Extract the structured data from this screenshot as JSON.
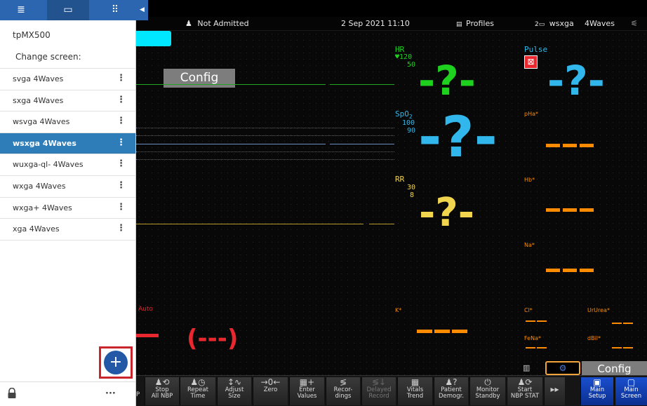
{
  "panel": {
    "title": "tpMX500",
    "heading": "Change screen:",
    "tabs": [
      {
        "icon": "list-settings-icon",
        "glyph": "≣"
      },
      {
        "icon": "screen-settings-icon",
        "glyph": "▭"
      },
      {
        "icon": "grid-icon",
        "glyph": "⠿"
      }
    ],
    "collapse_glyph": "◀",
    "screens": [
      {
        "label": "svga 4Waves",
        "selected": false
      },
      {
        "label": "sxga 4Waves",
        "selected": false
      },
      {
        "label": "wsvga 4Waves",
        "selected": false
      },
      {
        "label": "wsxga 4Waves",
        "selected": true
      },
      {
        "label": "wuxga-ql- 4Waves",
        "selected": false
      },
      {
        "label": "wxga 4Waves",
        "selected": false
      },
      {
        "label": "wxga+ 4Waves",
        "selected": false
      },
      {
        "label": "xga 4Waves",
        "selected": false
      }
    ],
    "kebab": "⋮",
    "add_glyph": "+",
    "more_glyph": "···"
  },
  "status": {
    "patient": "Not Admitted",
    "datetime": "2 Sep 2021 11:10",
    "profiles": "Profiles",
    "screen_name": "wsxga",
    "waves": "4Waves",
    "person_glyph": "♟",
    "profiles_glyph": "▤",
    "screen_glyph": "2▭",
    "end_glyph": "⚟"
  },
  "waves": {
    "config_label": "Config",
    "auto_label": "Auto",
    "nbp_value": "(---)"
  },
  "params": {
    "hr": {
      "label": "HR",
      "high": "120",
      "low": "50",
      "value": "-?-"
    },
    "spo2": {
      "label": "SpO",
      "sub": "2",
      "high": "100",
      "low": "90",
      "value": "-?-"
    },
    "rr": {
      "label": "RR",
      "high": "30",
      "low": "8",
      "value": "-?-"
    },
    "pulse": {
      "label": "Pulse",
      "value": "-?-"
    },
    "labs": {
      "pha": "pHa*",
      "hb": "Hb*",
      "na": "Na*",
      "k": "K*",
      "cl": "Cl*",
      "urea": "UrUrea*",
      "fena": "FeNa*",
      "dbil": "dBil*"
    }
  },
  "toolbar": {
    "config_label": "Config",
    "buttons": [
      {
        "line1": "Stop",
        "line2": "All NBP",
        "icon": "♟⟲",
        "dim": false
      },
      {
        "line1": "Repeat",
        "line2": "Time",
        "icon": "♟◷",
        "dim": false
      },
      {
        "line1": "Adjust",
        "line2": "Size",
        "icon": "↕∿",
        "dim": false
      },
      {
        "line1": "Zero",
        "line2": "",
        "icon": "→0←",
        "dim": false
      },
      {
        "line1": "Enter",
        "line2": "Values",
        "icon": "▦+",
        "dim": false
      },
      {
        "line1": "Recor-",
        "line2": "dings",
        "icon": "≶",
        "dim": false
      },
      {
        "line1": "Delayed",
        "line2": "Record",
        "icon": "≶↓",
        "dim": true
      },
      {
        "line1": "Vitals",
        "line2": "Trend",
        "icon": "▦",
        "dim": false
      },
      {
        "line1": "Patient",
        "line2": "Demogr.",
        "icon": "♟?",
        "dim": false
      },
      {
        "line1": "Monitor",
        "line2": "Standby",
        "icon": "⏻",
        "dim": false
      },
      {
        "line1": "Start",
        "line2": "NBP STAT",
        "icon": "♟⟳",
        "dim": false
      },
      {
        "line1": "",
        "line2": "",
        "icon": "▸▸",
        "dim": false
      },
      {
        "line1": "Main",
        "line2": "Setup",
        "icon": "▣",
        "dim": false,
        "blue": true
      },
      {
        "line1": "Main",
        "line2": "Screen",
        "icon": "▢",
        "dim": false,
        "blue": true
      }
    ],
    "left_fragment": "P"
  },
  "colors": {
    "hr": "#1fd11f",
    "spo2": "#32b7ec",
    "rr": "#f2d54e",
    "lab": "#ff8c00",
    "alarm": "#e8282e",
    "panel_blue": "#2d66b0",
    "selected_row": "#2e7db9"
  }
}
